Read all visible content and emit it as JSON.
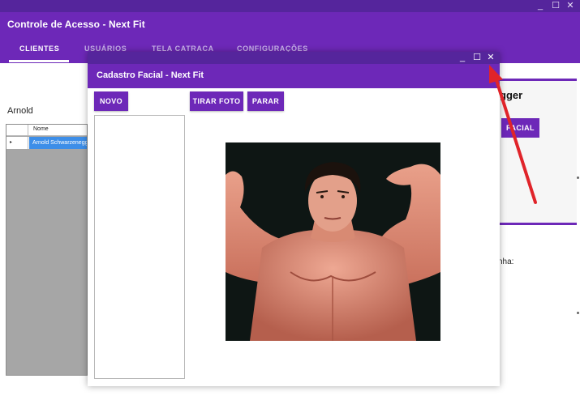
{
  "main_window": {
    "title": "Controle de Acesso - Next Fit",
    "controls": {
      "minimize": "_",
      "maximize": "☐",
      "close": "✕"
    },
    "tabs": [
      {
        "label": "CLIENTES",
        "active": true
      },
      {
        "label": "USUÁRIOS",
        "active": false
      },
      {
        "label": "TELA CATRACA",
        "active": false
      },
      {
        "label": "CONFIGURAÇÕES",
        "active": false
      }
    ],
    "search_value": "Arnold",
    "grid": {
      "column_header": "Nome",
      "rows": [
        {
          "marker": "▸",
          "name": "Arnold Schwarzenegger"
        }
      ]
    },
    "card": {
      "name_visible": "gger",
      "facial_button": "FACIAL"
    },
    "senha_label_visible": "nha:"
  },
  "dialog": {
    "title": "Cadastro Facial - Next Fit",
    "controls": {
      "minimize": "_",
      "maximize": "☐",
      "close": "✕"
    },
    "buttons": {
      "novo": "NOVO",
      "tirar_foto": "TIRAR FOTO",
      "parar": "PARAR"
    }
  },
  "colors": {
    "accent": "#6d28b8",
    "titlebar": "#55259c",
    "selection": "#3d8ee8",
    "annotation_arrow": "#e0242a"
  }
}
